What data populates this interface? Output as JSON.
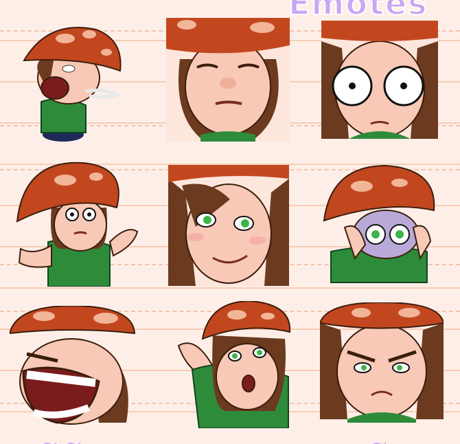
{
  "sheet": {
    "title_fragment": "Emotes",
    "colors": {
      "background": "#fdefe8",
      "cap": "#c2471f",
      "cap_spot": "#f2b597",
      "skin": "#f7c9b6",
      "hair": "#6b3a1f",
      "hoodie": "#2e8b3a",
      "accent": "#c9a7f2"
    }
  },
  "emotes": [
    {
      "name": "coughing-mushroom-elf",
      "expression": "coughing"
    },
    {
      "name": "unimpressed-stare",
      "expression": "unimpressed"
    },
    {
      "name": "wide-eyed-stare",
      "expression": "shocked"
    },
    {
      "name": "shrug",
      "expression": "shrug"
    },
    {
      "name": "smug-smile",
      "expression": "smug"
    },
    {
      "name": "hiding-peek",
      "expression": "peek"
    },
    {
      "name": "rage-scream",
      "expression": "rage"
    },
    {
      "name": "pointing-surprise",
      "expression": "surprised"
    },
    {
      "name": "angry-glare",
      "expression": "angry"
    }
  ]
}
